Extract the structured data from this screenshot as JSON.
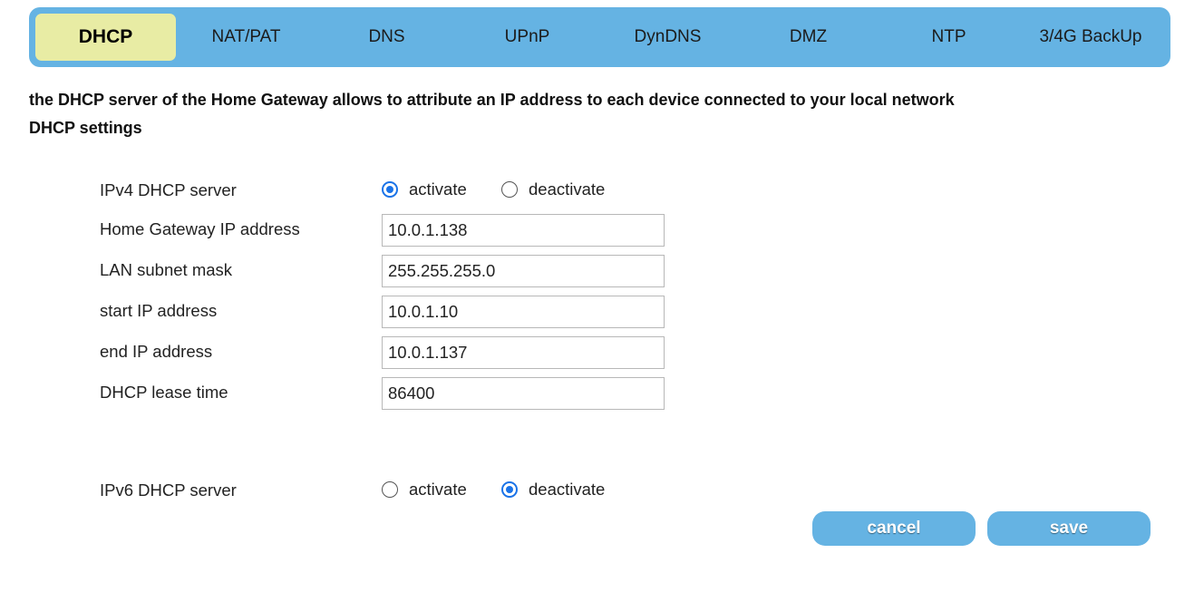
{
  "tabs": [
    {
      "label": "DHCP",
      "active": true
    },
    {
      "label": "NAT/PAT",
      "active": false
    },
    {
      "label": "DNS",
      "active": false
    },
    {
      "label": "UPnP",
      "active": false
    },
    {
      "label": "DynDNS",
      "active": false
    },
    {
      "label": "DMZ",
      "active": false
    },
    {
      "label": "NTP",
      "active": false
    },
    {
      "label": "3/4G BackUp",
      "active": false
    }
  ],
  "intro": {
    "description": "the DHCP server of the Home Gateway allows to attribute an IP address to each device connected to your local network",
    "section_title": "DHCP settings"
  },
  "ipv4": {
    "label": "IPv4 DHCP server",
    "options": [
      {
        "label": "activate",
        "checked": true
      },
      {
        "label": "deactivate",
        "checked": false
      }
    ]
  },
  "fields": [
    {
      "label": "Home Gateway IP address",
      "value": "10.0.1.138"
    },
    {
      "label": "LAN subnet mask",
      "value": "255.255.255.0"
    },
    {
      "label": "start IP address",
      "value": "10.0.1.10"
    },
    {
      "label": "end IP address",
      "value": "10.0.1.137"
    },
    {
      "label": "DHCP lease time",
      "value": "86400"
    }
  ],
  "ipv6": {
    "label": "IPv6 DHCP server",
    "options": [
      {
        "label": "activate",
        "checked": false
      },
      {
        "label": "deactivate",
        "checked": true
      }
    ]
  },
  "buttons": {
    "cancel": "cancel",
    "save": "save"
  },
  "colors": {
    "tab_bar": "#65b3e3",
    "tab_active": "#e8eca4",
    "radio_checked": "#1a73e8",
    "button": "#65b3e3"
  }
}
